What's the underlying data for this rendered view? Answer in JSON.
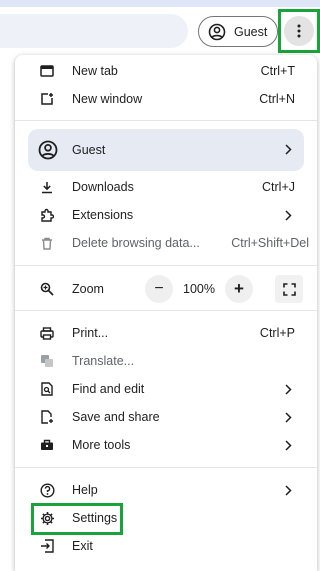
{
  "toolbar": {
    "guest_label": "Guest",
    "profile_icon": "account-circle-icon",
    "menu_icon": "kebab-menu-icon"
  },
  "menu": {
    "new_tab": {
      "label": "New tab",
      "shortcut": "Ctrl+T",
      "icon": "new-tab-icon"
    },
    "new_window": {
      "label": "New window",
      "shortcut": "Ctrl+N",
      "icon": "new-window-icon"
    },
    "guest": {
      "label": "Guest",
      "icon": "account-circle-icon"
    },
    "downloads": {
      "label": "Downloads",
      "shortcut": "Ctrl+J",
      "icon": "download-icon"
    },
    "extensions": {
      "label": "Extensions",
      "icon": "puzzle-icon"
    },
    "delete_data": {
      "label": "Delete browsing data...",
      "shortcut": "Ctrl+Shift+Del",
      "icon": "trash-icon"
    },
    "zoom": {
      "label": "Zoom",
      "value": "100%",
      "minus": "−",
      "plus": "+",
      "icon": "zoom-icon"
    },
    "print": {
      "label": "Print...",
      "shortcut": "Ctrl+P",
      "icon": "print-icon"
    },
    "translate": {
      "label": "Translate...",
      "icon": "translate-icon"
    },
    "find_edit": {
      "label": "Find and edit",
      "icon": "find-icon"
    },
    "save_share": {
      "label": "Save and share",
      "icon": "save-icon"
    },
    "more_tools": {
      "label": "More tools",
      "icon": "toolbox-icon"
    },
    "help": {
      "label": "Help",
      "icon": "help-icon"
    },
    "settings": {
      "label": "Settings",
      "icon": "gear-icon"
    },
    "exit": {
      "label": "Exit",
      "icon": "exit-icon"
    }
  },
  "colors": {
    "highlight": "#1aa33b",
    "guest_row_bg": "#e6eaf3",
    "text": "#1f1f1f",
    "muted": "#5f6368"
  }
}
